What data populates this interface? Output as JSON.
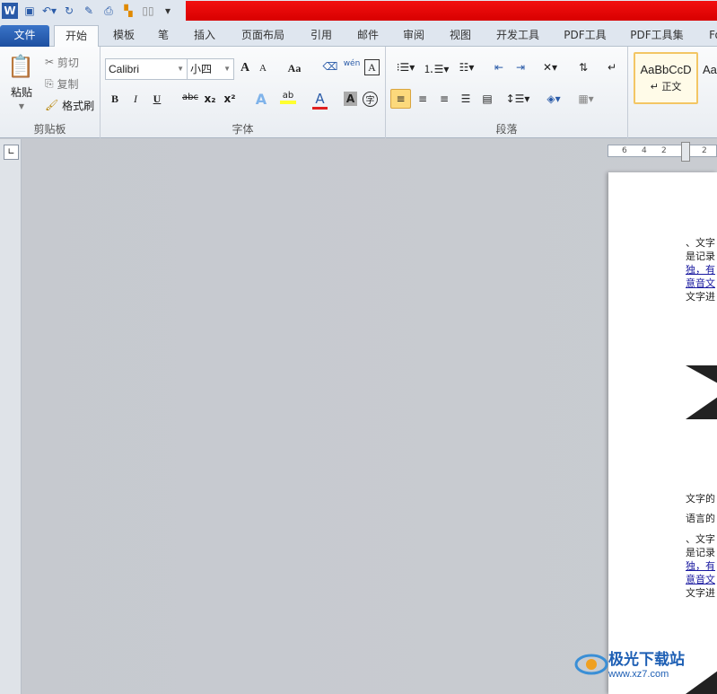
{
  "qat": {
    "icons": [
      "word-logo-icon",
      "save-icon",
      "undo-icon",
      "redo-icon",
      "edit-icon",
      "print-preview-icon",
      "layout-icon",
      "read-icon",
      "customize-icon"
    ]
  },
  "tabs": [
    "文件",
    "开始",
    "模板",
    "笔",
    "插入",
    "页面布局",
    "引用",
    "邮件",
    "审阅",
    "视图",
    "开发工具",
    "PDF工具",
    "PDF工具集",
    "Fo"
  ],
  "clipboard": {
    "paste": "粘贴",
    "cut": "剪切",
    "copy": "复制",
    "format_painter": "格式刷",
    "label": "剪贴板"
  },
  "font": {
    "name": "Calibri",
    "size": "小四",
    "label": "字体",
    "grow": "A",
    "shrink": "A",
    "case": "Aa",
    "bold": "B",
    "italic": "I",
    "underline": "U",
    "strike": "abc",
    "sub": "x₂",
    "sup": "x²",
    "color_a": "A",
    "shade_a": "A",
    "enclose": "字",
    "phonetic": "wén"
  },
  "paragraph": {
    "label": "段落"
  },
  "styles": {
    "sample": "AaBbCcD",
    "name": "正文",
    "sample2": "Aa"
  },
  "ruler": [
    "6",
    "4",
    "2",
    "2"
  ],
  "doc": {
    "lines": [
      "、文字",
      "是记录",
      "独，有",
      "意音文",
      "文字进",
      "文字的",
      "语言的",
      "、文字",
      "是记录",
      "独，有",
      "意音文",
      "文字进"
    ]
  },
  "watermark": {
    "name": "极光下载站",
    "url": "www.xz7.com"
  }
}
